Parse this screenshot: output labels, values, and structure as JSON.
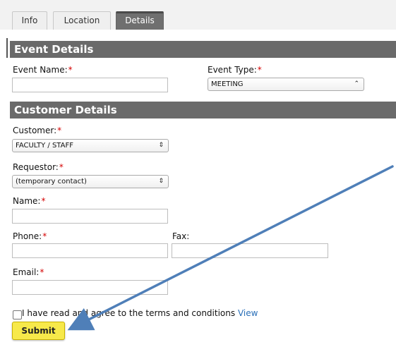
{
  "tabs": [
    {
      "label": "Info",
      "active": false
    },
    {
      "label": "Location",
      "active": false
    },
    {
      "label": "Details",
      "active": true
    }
  ],
  "sections": {
    "event": {
      "title": "Event Details",
      "event_name_label": "Event Name:",
      "event_name_value": "",
      "event_type_label": "Event Type:",
      "event_type_selected": "MEETING"
    },
    "customer": {
      "title": "Customer Details",
      "customer_label": "Customer:",
      "customer_selected": "FACULTY / STAFF",
      "requestor_label": "Requestor:",
      "requestor_selected": "(temporary contact)",
      "name_label": "Name:",
      "name_value": "",
      "phone_label": "Phone:",
      "phone_value": "",
      "fax_label": "Fax:",
      "fax_value": "",
      "email_label": "Email:",
      "email_value": ""
    }
  },
  "required_marker": "*",
  "terms": {
    "checked": false,
    "text": "I have read and agree to the terms and conditions",
    "link": "View"
  },
  "submit_label": "Submit",
  "icons": {
    "select_chevron": "updown-chevron-icon",
    "annotation": "arrow-annotation"
  },
  "colors": {
    "section_header": "#6a6a6a",
    "required": "#d40000",
    "submit_bg": "#f7e94a",
    "annotation_arrow": "#4f7fb8",
    "link": "#2a6fb8"
  }
}
